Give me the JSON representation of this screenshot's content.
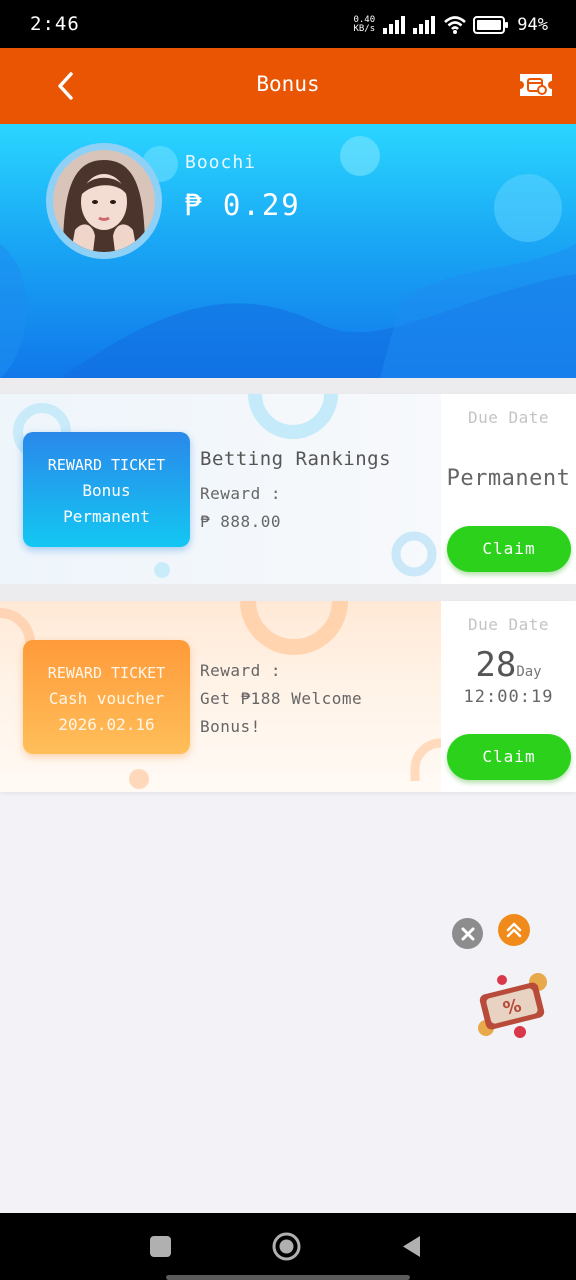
{
  "status_bar": {
    "time": "2:46",
    "net_speed_value": "0.40",
    "net_speed_unit": "KB/s",
    "battery": "94%"
  },
  "header": {
    "title": "Bonus",
    "back_icon": "chevron-left-icon",
    "ticket_icon": "ticket-icon"
  },
  "profile": {
    "username": "Boochi",
    "balance": "₱ 0.29"
  },
  "cards": [
    {
      "ticket_line1": "REWARD TICKET",
      "ticket_line2": "Bonus",
      "ticket_line3": "Permanent",
      "title": "Betting Rankings",
      "reward_label": "Reward :",
      "reward_value": "₱ 888.00",
      "due_label": "Due Date",
      "due_value": "Permanent",
      "claim_label": "Claim",
      "color": "#1aa8f5"
    },
    {
      "ticket_line1": "REWARD TICKET",
      "ticket_line2": "Cash voucher",
      "ticket_line3": "2026.02.16",
      "reward_label": "Reward :",
      "reward_line1": "Get ₱188 Welcome",
      "reward_line2": "Bonus!",
      "due_label": "Due Date",
      "days": "28",
      "days_unit": "Day",
      "countdown": "12:00:19",
      "claim_label": "Claim",
      "color": "#ffa443"
    }
  ],
  "colors": {
    "header": "#e95503",
    "claim": "#2bd11b"
  }
}
